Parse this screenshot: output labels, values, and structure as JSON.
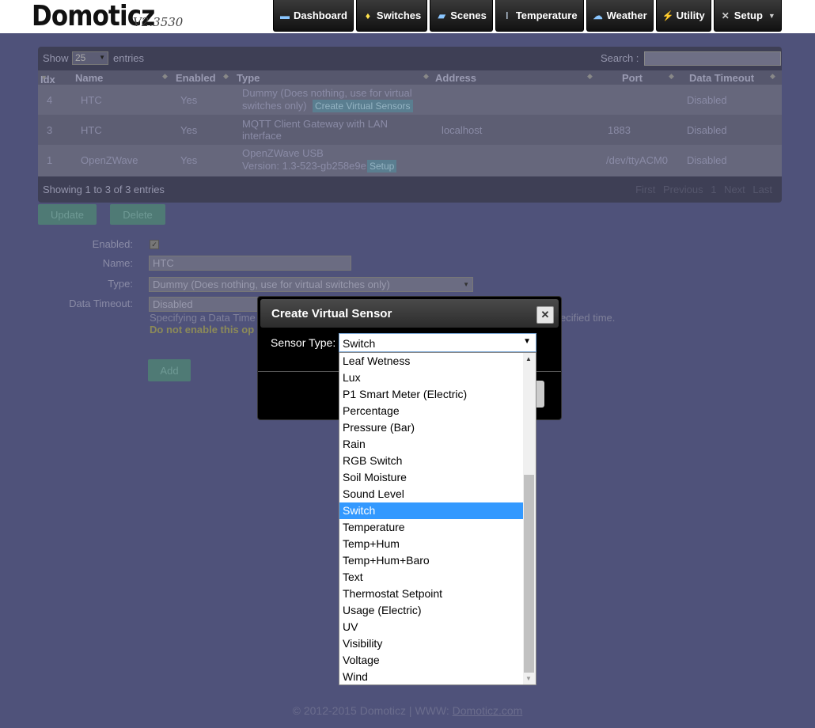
{
  "header": {
    "logo": "Domoticz",
    "version": "V2.3530",
    "nav": [
      "Dashboard",
      "Switches",
      "Scenes",
      "Temperature",
      "Weather",
      "Utility",
      "Setup"
    ]
  },
  "table": {
    "show_label": "Show",
    "page_size": "25",
    "entries_label": "entries",
    "search_label": "Search :",
    "columns": [
      "Idx",
      "Name",
      "Enabled",
      "Type",
      "Address",
      "Port",
      "Data Timeout"
    ],
    "rows": [
      {
        "idx": "4",
        "name": "HTC",
        "enabled": "Yes",
        "type_line1": "Dummy (Does nothing, use for virtual",
        "type_line2": "switches only)",
        "action": "Create Virtual Sensors",
        "address": "",
        "port": "",
        "timeout": "Disabled"
      },
      {
        "idx": "3",
        "name": "HTC",
        "enabled": "Yes",
        "type_line1": "MQTT Client Gateway with LAN",
        "type_line2": "interface",
        "action": "",
        "address": "localhost",
        "port": "1883",
        "timeout": "Disabled"
      },
      {
        "idx": "1",
        "name": "OpenZWave",
        "enabled": "Yes",
        "type_line1": "OpenZWave USB",
        "type_line2": "Version: 1.3-523-gb258e9e",
        "action": "Setup",
        "address": "",
        "port": "/dev/ttyACM0",
        "timeout": "Disabled"
      }
    ],
    "info": "Showing 1 to 3 of 3 entries",
    "pager": [
      "First",
      "Previous",
      "1",
      "Next",
      "Last"
    ]
  },
  "buttons": {
    "update": "Update",
    "delete": "Delete",
    "add": "Add"
  },
  "form": {
    "enabled_label": "Enabled:",
    "name_label": "Name:",
    "name_value": "HTC",
    "type_label": "Type:",
    "type_value": "Dummy (Does nothing, use for virtual switches only)",
    "timeout_label": "Data Timeout:",
    "timeout_value": "Disabled",
    "hint_left": "Specifying a Data Time",
    "hint_right": "ecified time.",
    "warning": "Do not enable this op"
  },
  "modal": {
    "title": "Create Virtual Sensor",
    "sensor_type_label": "Sensor Type:",
    "selected": "Switch",
    "options": [
      "Leaf Wetness",
      "Lux",
      "P1 Smart Meter (Electric)",
      "Percentage",
      "Pressure (Bar)",
      "Rain",
      "RGB Switch",
      "Soil Moisture",
      "Sound Level",
      "Switch",
      "Temperature",
      "Temp+Hum",
      "Temp+Hum+Baro",
      "Text",
      "Thermostat Setpoint",
      "Usage (Electric)",
      "UV",
      "Visibility",
      "Voltage",
      "Wind"
    ]
  },
  "footer": {
    "text": "© 2012-2015 Domoticz | WWW: ",
    "link": "Domoticz.com"
  }
}
